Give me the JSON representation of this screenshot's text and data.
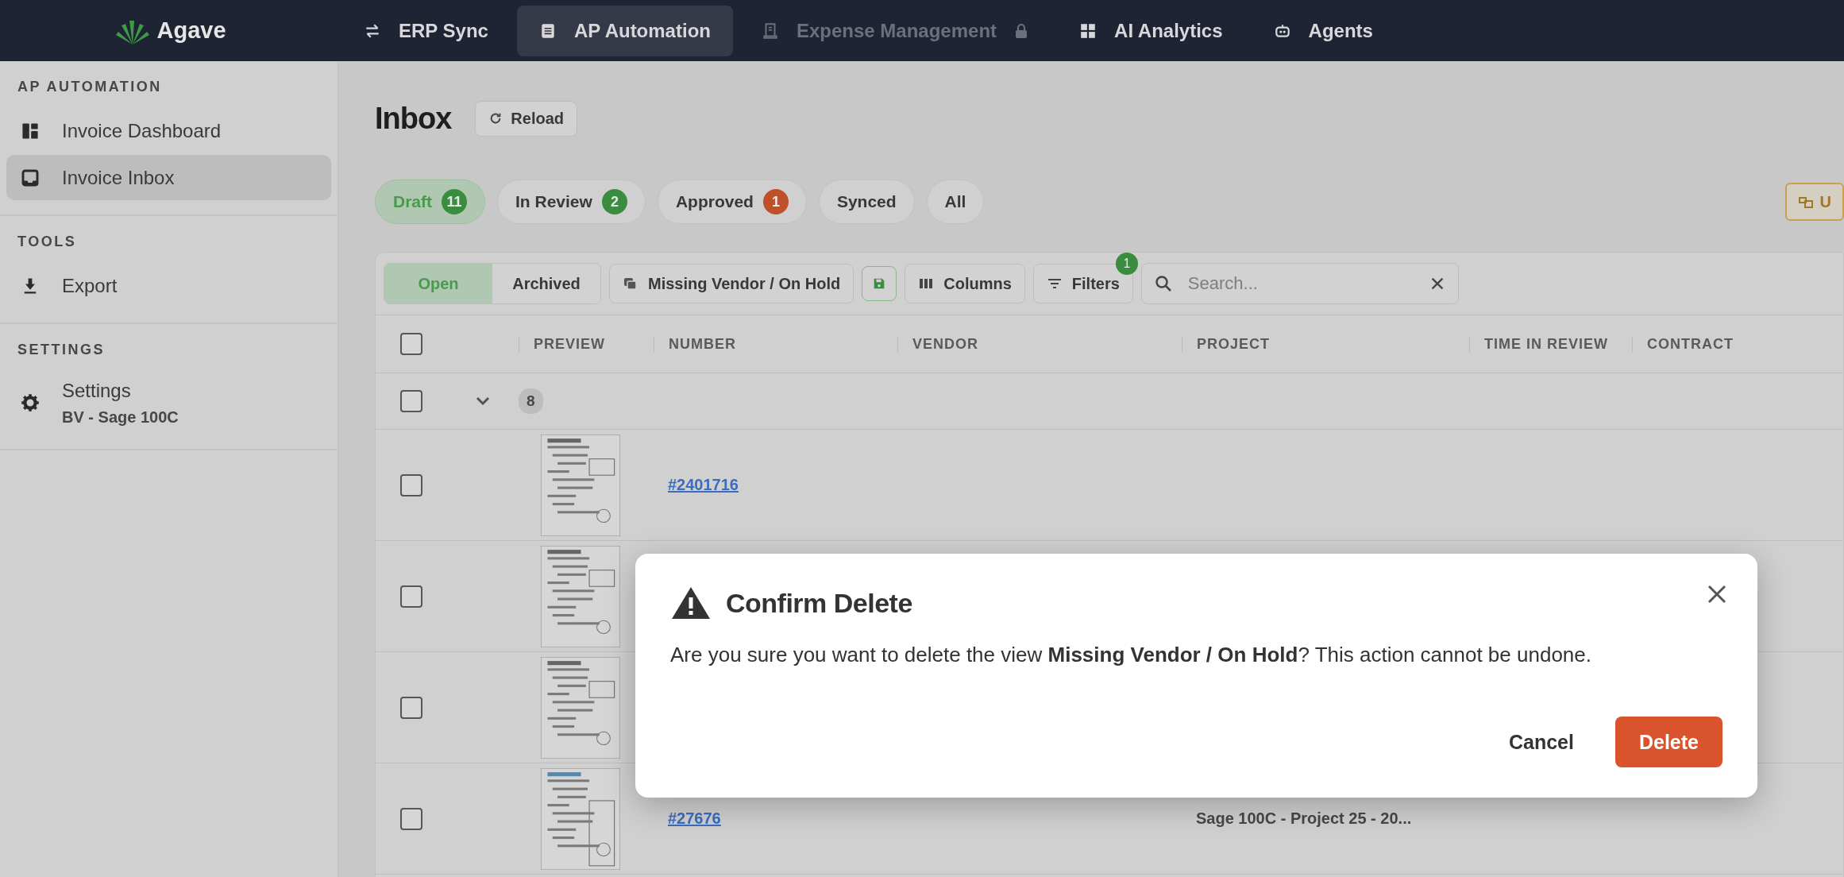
{
  "nav": {
    "logo": "Agave",
    "items": [
      {
        "label": "ERP Sync",
        "selected": false,
        "locked": false
      },
      {
        "label": "AP Automation",
        "selected": true,
        "locked": false
      },
      {
        "label": "Expense Management",
        "selected": false,
        "locked": true
      },
      {
        "label": "AI Analytics",
        "selected": false,
        "locked": false
      },
      {
        "label": "Agents",
        "selected": false,
        "locked": false
      }
    ]
  },
  "sidebar": {
    "sections": [
      {
        "heading": "AP AUTOMATION",
        "items": [
          {
            "label": "Invoice Dashboard",
            "selected": false
          },
          {
            "label": "Invoice Inbox",
            "selected": true
          }
        ]
      },
      {
        "heading": "TOOLS",
        "items": [
          {
            "label": "Export",
            "selected": false
          }
        ]
      },
      {
        "heading": "SETTINGS",
        "items": [
          {
            "label": "Settings",
            "sublabel": "BV - Sage 100C",
            "selected": false
          }
        ]
      }
    ]
  },
  "page": {
    "title": "Inbox",
    "reload": "Reload"
  },
  "status_tabs": [
    {
      "label": "Draft",
      "count": "11",
      "color": "#3a8c3f",
      "selected": true
    },
    {
      "label": "In Review",
      "count": "2",
      "color": "#3a8c3f",
      "selected": false
    },
    {
      "label": "Approved",
      "count": "1",
      "color": "#c0502a",
      "selected": false
    },
    {
      "label": "Synced",
      "selected": false
    },
    {
      "label": "All",
      "selected": false
    }
  ],
  "edge_button": "U",
  "toolbar": {
    "segments": [
      {
        "label": "Open",
        "selected": true
      },
      {
        "label": "Archived",
        "selected": false
      }
    ],
    "view": "Missing Vendor / On Hold",
    "columns": "Columns",
    "filters": "Filters",
    "filters_count": "1",
    "search": {
      "placeholder": "Search..."
    }
  },
  "table": {
    "all_checked": false,
    "columns": [
      "PREVIEW",
      "NUMBER",
      "VENDOR",
      "PROJECT",
      "TIME IN REVIEW",
      "CONTRACT"
    ],
    "group": {
      "count": "8",
      "checked": false,
      "expanded": true
    },
    "rows": [
      {
        "checked": false,
        "number": "#2401716"
      },
      {
        "checked": false
      },
      {
        "checked": false
      },
      {
        "checked": false,
        "number": "#27676",
        "project": "Sage 100C - Project 25 - 20..."
      }
    ]
  },
  "dialog": {
    "title": "Confirm Delete",
    "message": "Are you sure you want to delete the view **Missing Vendor / On Hold**? This action cannot be undone.",
    "buttons": [
      {
        "label": "Cancel",
        "kind": "text"
      },
      {
        "label": "Delete",
        "kind": "danger"
      }
    ]
  }
}
